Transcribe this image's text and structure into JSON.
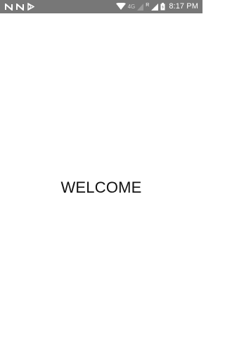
{
  "status_bar": {
    "background": "#777777",
    "notifications": [
      {
        "icon": "n-letter-icon"
      },
      {
        "icon": "n-letter-icon"
      },
      {
        "icon": "play-store-icon"
      }
    ],
    "network_type": "4G",
    "roaming_indicator": "R",
    "time": "8:17 PM"
  },
  "main": {
    "welcome_text": "WELCOME"
  }
}
